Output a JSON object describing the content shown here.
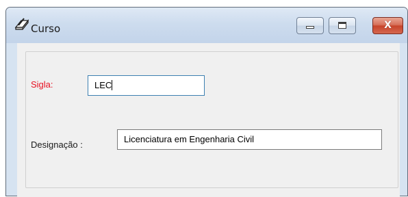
{
  "window": {
    "title": "Curso",
    "icon": "book-pencil-icon",
    "controls": {
      "minimize": "minimize",
      "maximize": "maximize",
      "close": "X"
    }
  },
  "form": {
    "sigla": {
      "label": "Sigla:",
      "value": "LEC"
    },
    "designacao": {
      "label": "Designação :",
      "value": "Licenciatura em Engenharia Civil"
    }
  },
  "colors": {
    "required_label": "#e81123",
    "focused_border": "#3c7fb1"
  }
}
